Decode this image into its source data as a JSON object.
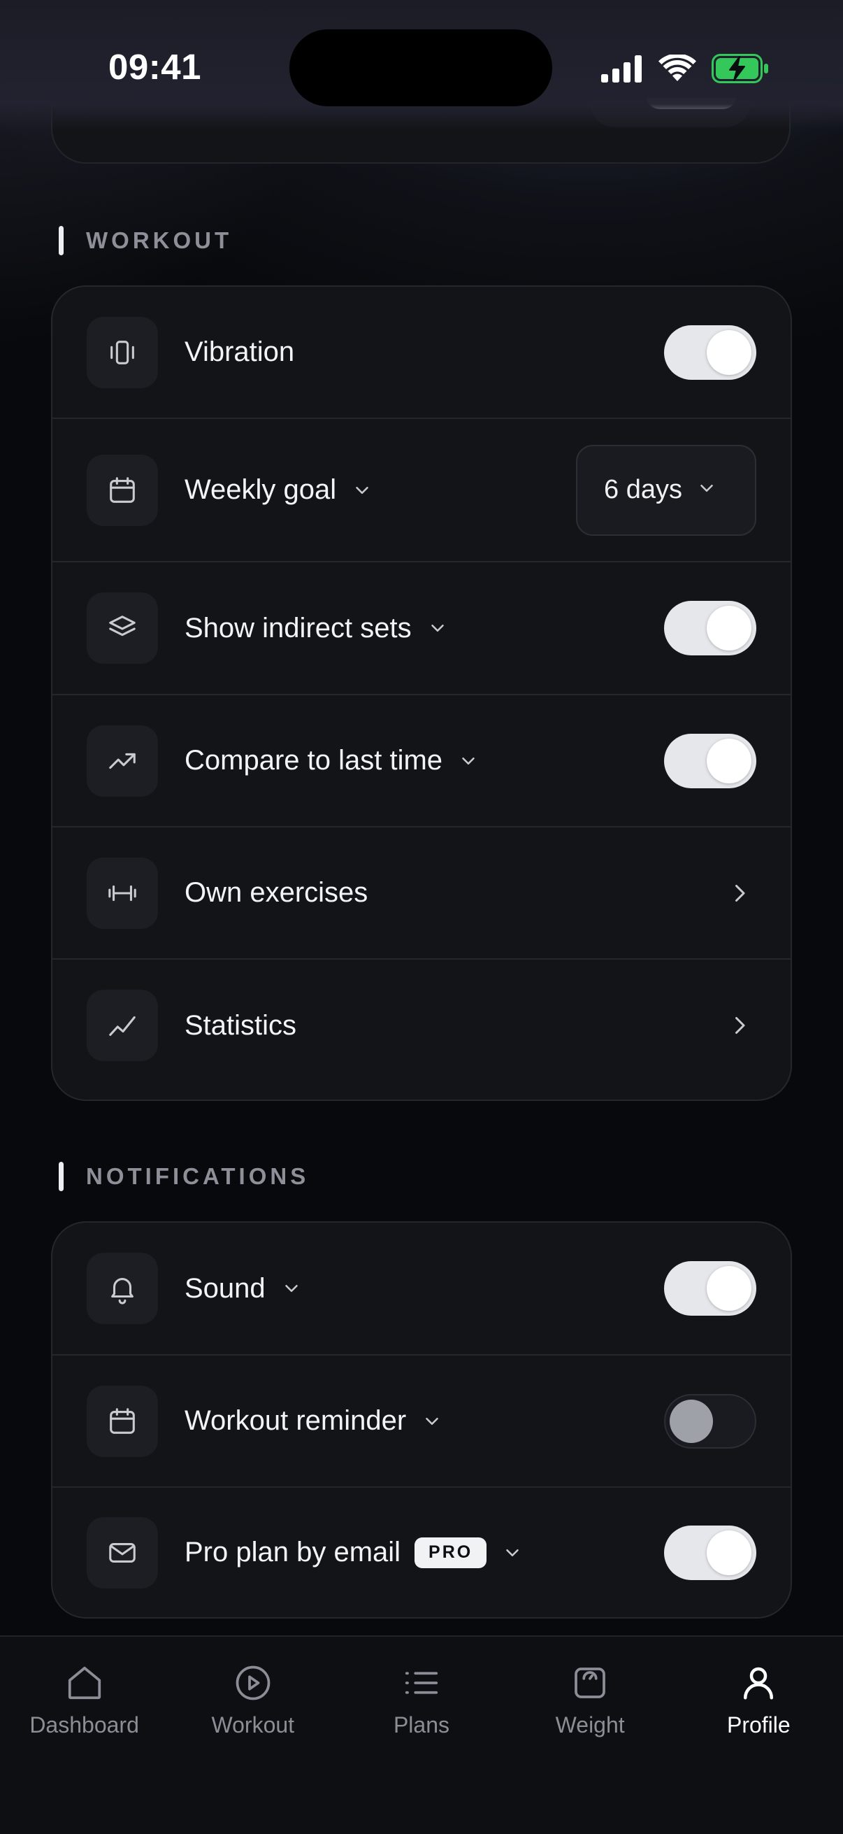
{
  "status_bar": {
    "time": "09:41"
  },
  "sections": {
    "workout": {
      "title": "WORKOUT",
      "rows": [
        {
          "label": "Vibration",
          "icon": "vibration-icon",
          "control": "toggle",
          "on": true
        },
        {
          "label": "Weekly goal",
          "icon": "calendar-icon",
          "control": "select",
          "value": "6 days",
          "expandable": true
        },
        {
          "label": "Show indirect sets",
          "icon": "layers-icon",
          "control": "toggle",
          "on": true,
          "expandable": true
        },
        {
          "label": "Compare to last time",
          "icon": "trending-up-icon",
          "control": "toggle",
          "on": true,
          "expandable": true
        },
        {
          "label": "Own exercises",
          "icon": "dumbbell-icon",
          "control": "chevron"
        },
        {
          "label": "Statistics",
          "icon": "line-chart-icon",
          "control": "chevron"
        }
      ]
    },
    "notifications": {
      "title": "NOTIFICATIONS",
      "rows": [
        {
          "label": "Sound",
          "icon": "bell-icon",
          "control": "toggle",
          "on": true,
          "expandable": true
        },
        {
          "label": "Workout reminder",
          "icon": "calendar-icon",
          "control": "toggle",
          "on": false,
          "expandable": true
        },
        {
          "label": "Pro plan by email",
          "badge": "PRO",
          "icon": "mail-icon",
          "control": "toggle",
          "on": true,
          "expandable": true
        }
      ]
    }
  },
  "tab_bar": {
    "tabs": [
      {
        "label": "Dashboard",
        "icon": "home-icon",
        "active": false
      },
      {
        "label": "Workout",
        "icon": "play-circle-icon",
        "active": false
      },
      {
        "label": "Plans",
        "icon": "list-icon",
        "active": false
      },
      {
        "label": "Weight",
        "icon": "scale-icon",
        "active": false
      },
      {
        "label": "Profile",
        "icon": "user-icon",
        "active": true
      }
    ]
  },
  "colors": {
    "background": "#08090c",
    "card": "#131418",
    "toggle_on": "#e6e7ea",
    "toggle_off_knob": "#9ea1a8",
    "battery_green": "#34c759",
    "muted_text": "#8d9099"
  }
}
